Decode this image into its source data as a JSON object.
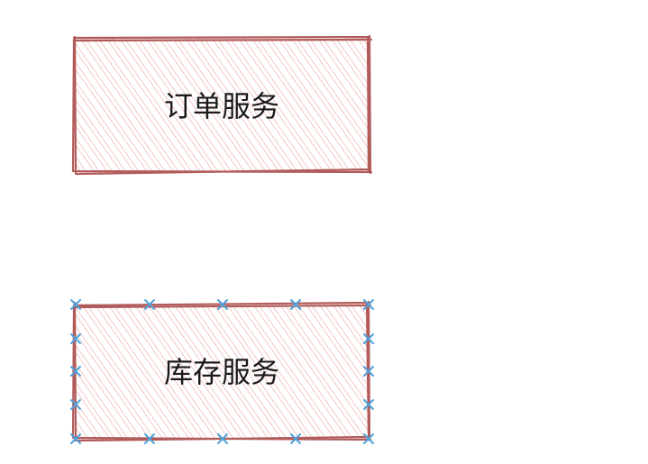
{
  "colors": {
    "stroke": "#b15c5a",
    "hatch": "#f0b9b7",
    "handle": "#4da3dd",
    "text": "#1a1a1a",
    "background": "#ffffff"
  },
  "boxes": [
    {
      "id": "order-service",
      "label": "订单服务",
      "selected": false
    },
    {
      "id": "inventory-service",
      "label": "库存服务",
      "selected": true
    }
  ]
}
